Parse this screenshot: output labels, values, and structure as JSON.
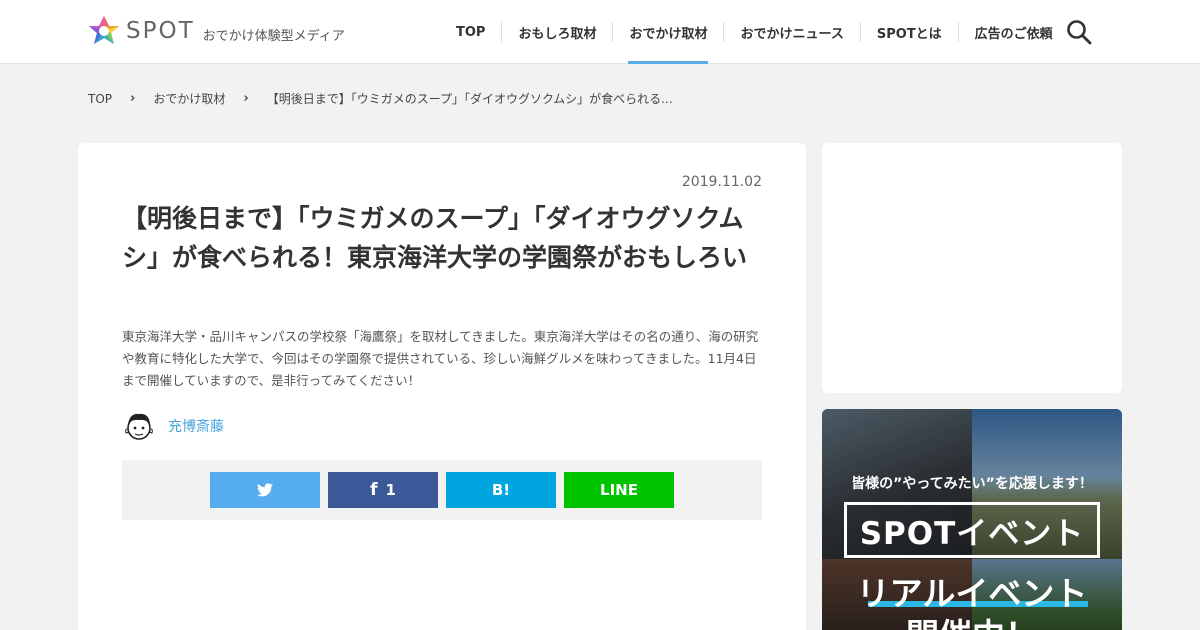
{
  "header": {
    "logo_text": "SPOT",
    "tagline": "おでかけ体験型メディア",
    "nav": [
      "TOP",
      "おもしろ取材",
      "おでかけ取材",
      "おでかけニュース",
      "SPOTとは",
      "広告のご依頼"
    ],
    "active_nav": "おでかけ取材",
    "search_icon": "search-icon"
  },
  "breadcrumb": [
    "TOP",
    "おでかけ取材",
    "【明後日まで】「ウミガメのスープ」「ダイオウグソクムシ」が食べられる..."
  ],
  "article": {
    "date": "2019.11.02",
    "title": "【明後日まで】「ウミガメのスープ」「ダイオウグソクムシ」が食べられる！東京海洋大学の学園祭がおもしろい",
    "lead": "東京海洋大学・品川キャンパスの学校祭「海鷹祭」を取材してきました。東京海洋大学はその名の通り、海の研究や教育に特化した大学で、今回はその学園祭で提供されている、珍しい海鮮グルメを味わってきました。11月4日まで開催していますので、是非行ってみてください！",
    "author": "充博斎藤"
  },
  "share": {
    "facebook_count": "1",
    "hatena_label": "B!",
    "line_label": "LINE"
  },
  "banner": {
    "tagline": "皆様の”やってみたい”を応援します！",
    "box_text": "SPOTイベント",
    "line1": "リアルイベント",
    "line2": "開催中！"
  },
  "colors": {
    "accent": "#5aaee6",
    "twitter": "#55acee",
    "facebook": "#3b5998",
    "hatena": "#00a4de",
    "line": "#00c300"
  }
}
